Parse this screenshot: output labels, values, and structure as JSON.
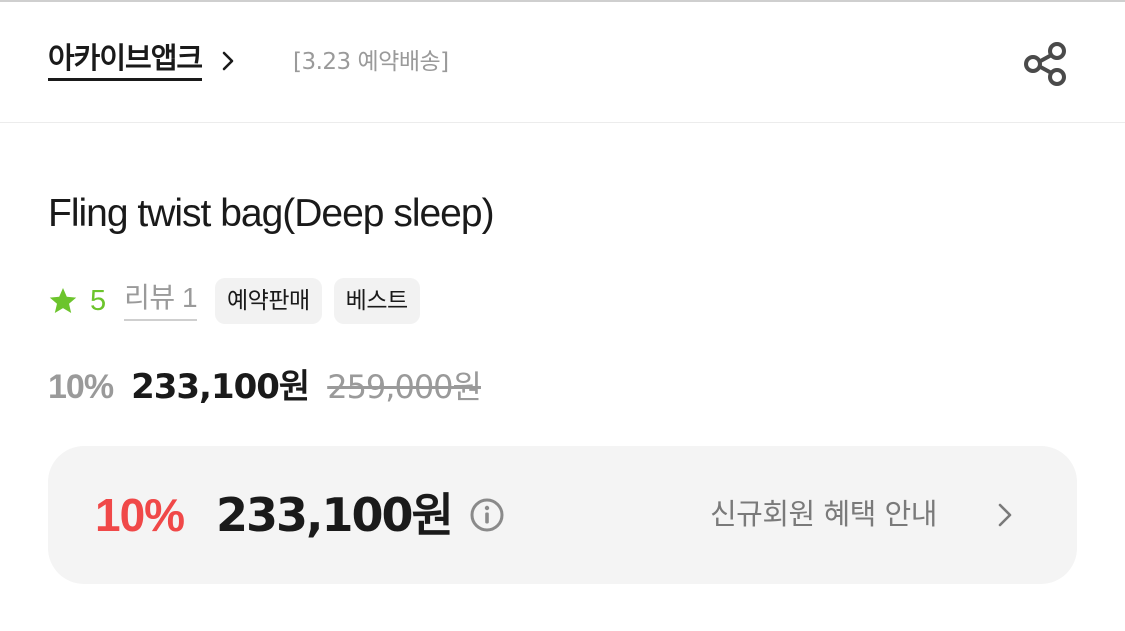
{
  "header": {
    "brand_name": "아카이브앱크",
    "brand_note": "[3.23 예약배송]",
    "icons": {
      "brand_chevron": "chevron-right-icon",
      "share": "share-icon"
    }
  },
  "product": {
    "title": "Fling twist bag(Deep sleep)",
    "rating": "5",
    "review_label": "리뷰 1",
    "badges": [
      "예약판매",
      "베스트"
    ],
    "accent_color": "#6cc42c"
  },
  "price": {
    "discount_rate": "10%",
    "sale_price": "233,100원",
    "original_price": "259,000원"
  },
  "member_benefit": {
    "discount_rate": "10%",
    "price": "233,100원",
    "guide_label": "신규회원 혜택 안내",
    "discount_color": "#f04848",
    "icons": {
      "info": "info-icon",
      "chevron": "chevron-right-icon"
    }
  }
}
